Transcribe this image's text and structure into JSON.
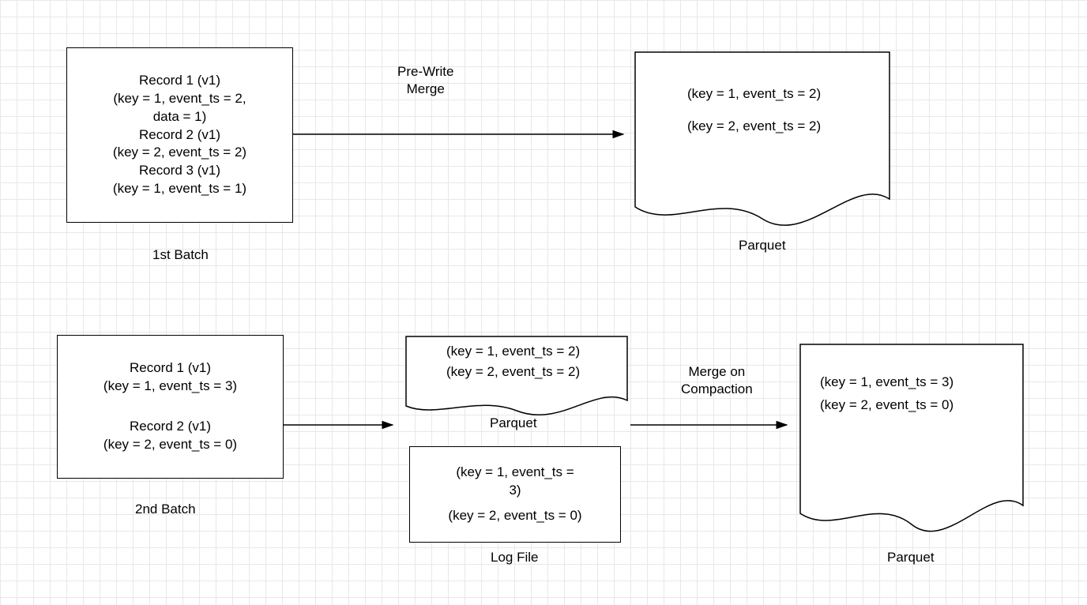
{
  "batch1": {
    "line1": "Record 1 (v1)",
    "line2": "(key = 1, event_ts = 2,",
    "line3": "data = 1)",
    "line4": "Record 2 (v1)",
    "line5": "(key = 2, event_ts = 2)",
    "line6": "Record 3 (v1)",
    "line7": "(key = 1, event_ts = 1)",
    "caption": "1st Batch"
  },
  "batch2": {
    "line1": "Record 1 (v1)",
    "line2": "(key = 1, event_ts = 3)",
    "line3": "Record 2 (v1)",
    "line4": "(key = 2, event_ts = 0)",
    "caption": "2nd Batch"
  },
  "arrow1_label": "Pre-Write\nMerge",
  "arrow2_label": "Merge on\nCompaction",
  "parquet1": {
    "line1": "(key = 1, event_ts = 2)",
    "line2": "(key = 2, event_ts = 2)",
    "caption": "Parquet"
  },
  "parquet_small": {
    "line1": "(key = 1, event_ts = 2)",
    "line2": "(key = 2, event_ts = 2)",
    "caption": "Parquet"
  },
  "logfile": {
    "line1": "(key = 1, event_ts =",
    "line2": "3)",
    "line3": "(key = 2, event_ts = 0)",
    "caption": "Log File"
  },
  "parquet3": {
    "line1": "(key = 1, event_ts = 3)",
    "line2": "(key = 2, event_ts = 0)",
    "caption": "Parquet"
  }
}
